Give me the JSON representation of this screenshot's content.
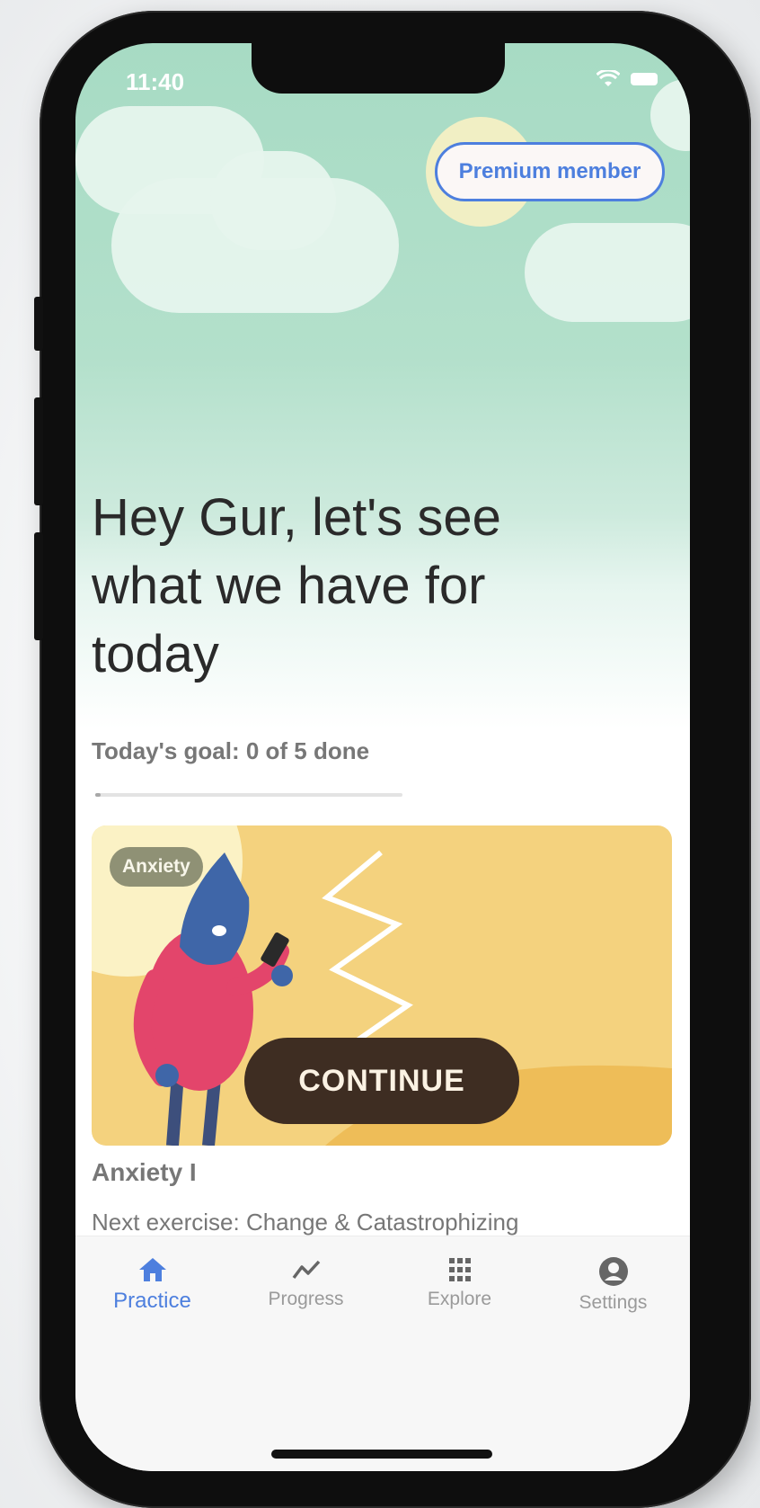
{
  "status": {
    "time": "11:40"
  },
  "header": {
    "premium_label": "Premium member"
  },
  "greeting": "Hey Gur, let's see what we have for today",
  "goal": {
    "text": "Today's goal: 0 of 5 done",
    "done": 0,
    "total": 5
  },
  "card": {
    "tag": "Anxiety",
    "continue_label": "CONTINUE",
    "course_title": "Anxiety I",
    "next_exercise": "Next exercise: Change & Catastrophizing"
  },
  "tabs": [
    {
      "label": "Practice",
      "icon": "home-icon",
      "active": true
    },
    {
      "label": "Progress",
      "icon": "trend-icon",
      "active": false
    },
    {
      "label": "Explore",
      "icon": "grid-icon",
      "active": false
    },
    {
      "label": "Settings",
      "icon": "account-icon",
      "active": false
    }
  ],
  "colors": {
    "accent": "#4d7fde",
    "card_bg": "#f4d27e",
    "button_bg": "#3e2d22"
  }
}
